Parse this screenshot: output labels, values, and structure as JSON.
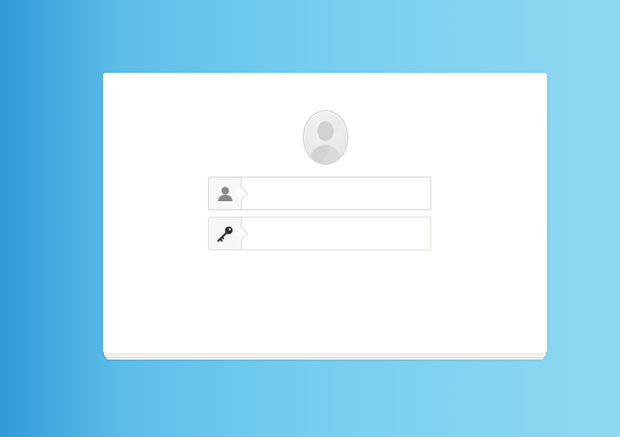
{
  "login": {
    "avatar_icon": "user-silhouette-icon",
    "username": {
      "icon": "user-icon",
      "value": "",
      "placeholder": ""
    },
    "password": {
      "icon": "key-icon",
      "value": "",
      "placeholder": ""
    }
  },
  "colors": {
    "background_left": "#2f9bd8",
    "background_right": "#8fd8f1",
    "card": "#ffffff",
    "field_border": "#d8d8d8",
    "icon": "#8a8a8a"
  }
}
